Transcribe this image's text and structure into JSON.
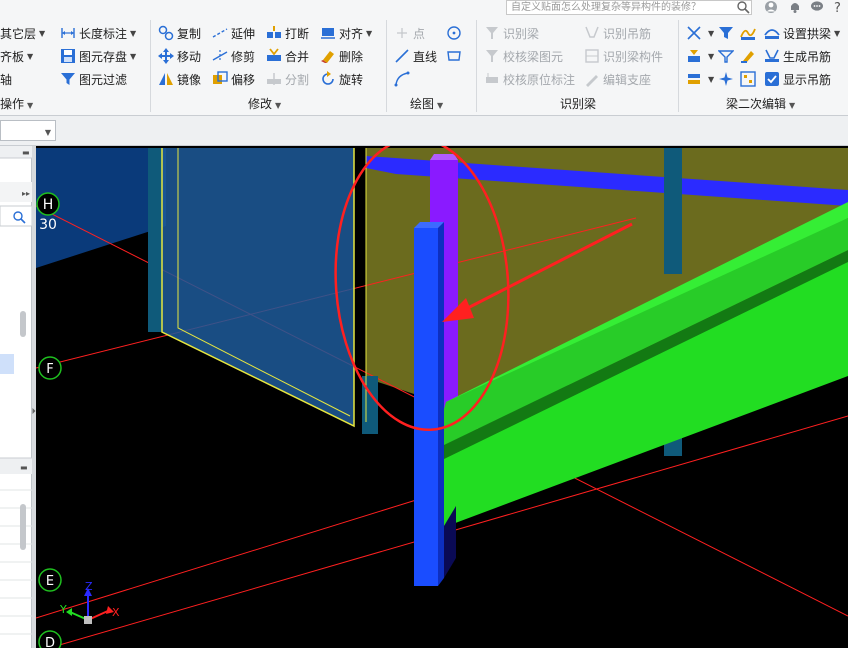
{
  "search": {
    "placeholder": "自定义贴面怎么处理复杂等异构件的装修？"
  },
  "ribbon": {
    "group_general": {
      "items": [
        "其它层",
        "齐板",
        "轴"
      ],
      "label": "操作"
    },
    "group_general2": {
      "items": [
        "长度标注",
        "图元存盘",
        "图元过滤"
      ]
    },
    "group_modify": {
      "label": "修改",
      "items": [
        "复制",
        "延伸",
        "打断",
        "对齐",
        "移动",
        "修剪",
        "合并",
        "删除",
        "镜像",
        "偏移",
        "分割",
        "旋转"
      ]
    },
    "group_draw": {
      "label": "绘图",
      "items": [
        "点",
        "直线"
      ]
    },
    "group_identify": {
      "label": "识别梁",
      "items": [
        "识别梁",
        "识别吊筋",
        "校核梁图元",
        "识别梁构件",
        "校核原位标注",
        "编辑支座"
      ]
    },
    "group_beam2": {
      "label": "梁二次编辑",
      "items": [
        "设置拱梁",
        "生成吊筋",
        "显示吊筋"
      ]
    }
  },
  "viewport": {
    "axis_labels": [
      "H",
      "30",
      "F",
      "E",
      "D"
    ],
    "coord_labels": {
      "z": "Z",
      "y": "Y",
      "x": "X"
    },
    "colors": {
      "background": "#000000",
      "wall": "#6b6b1e",
      "beam": "#22dd22",
      "column": "#1a4dff",
      "purple_column": "#8a1aff",
      "annotation": "#ff2020",
      "gridline": "#ff2020",
      "slab": "#0a3a7a",
      "dark_column": "#0f5a7a"
    }
  }
}
